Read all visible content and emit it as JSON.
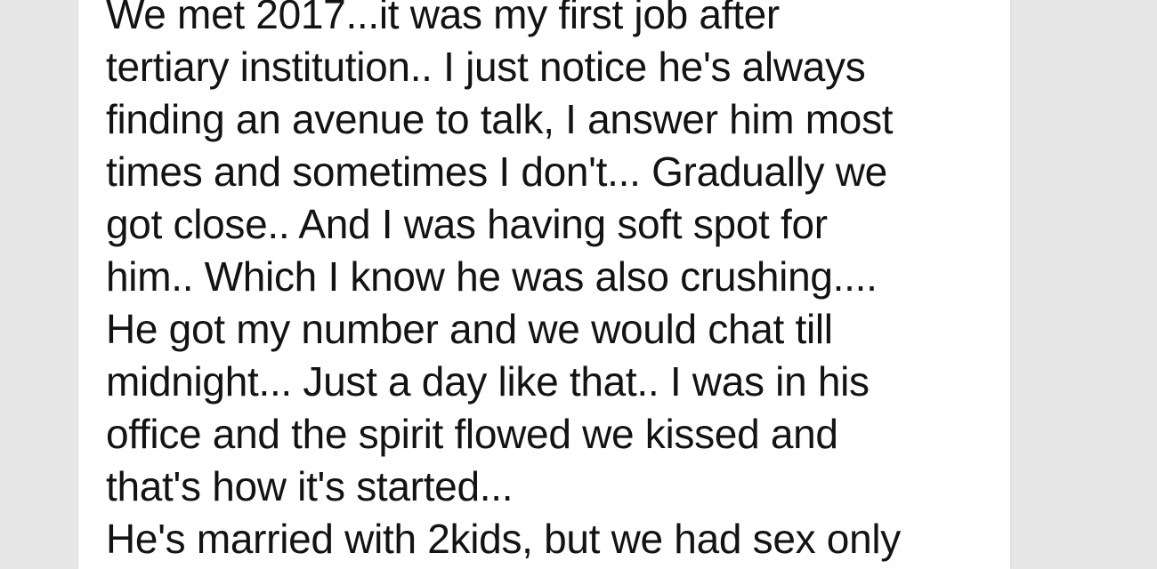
{
  "post": {
    "lines": [
      "We met 2017...it was my first job after",
      "tertiary institution.. I just notice he's always",
      "finding an avenue to talk, I answer him most",
      "times and sometimes I don't... Gradually we",
      "got close.. And I was having soft spot for",
      "him.. Which I know he was also crushing....",
      "He got my number and we would chat till",
      "midnight... Just a day like that.. I was in his",
      "office and the spirit flowed we kissed and",
      "that's how it's started...",
      "He's married with 2kids, but we had sex only"
    ]
  },
  "colors": {
    "background": "#e6e6e6",
    "card": "#ffffff",
    "text": "#131313"
  }
}
